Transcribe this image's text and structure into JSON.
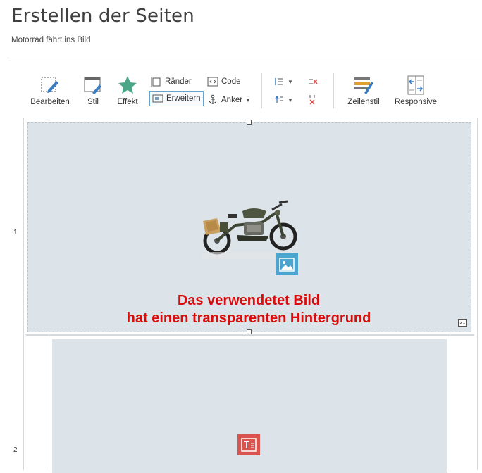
{
  "header": {
    "title": "Erstellen der Seiten",
    "subtitle": "Motorrad fährt ins Bild"
  },
  "toolbar": {
    "bearbeiten": "Bearbeiten",
    "stil": "Stil",
    "effekt": "Effekt",
    "raender": "Ränder",
    "erweitern": "Erweitern",
    "code": "Code",
    "anker": "Anker",
    "zeilenstil": "Zeilenstil",
    "responsive": "Responsive"
  },
  "canvas": {
    "rows": [
      {
        "number": "1",
        "caption_line1": "Das verwendetet Bild",
        "caption_line2": "hat einen transparenten Hintergrund"
      },
      {
        "number": "2"
      }
    ]
  },
  "colors": {
    "row_background": "#dce4e9",
    "caption": "#d90b0b",
    "image_badge": "#4ba5cf",
    "text_badge": "#d9534f",
    "effect_star": "#4aa889"
  }
}
